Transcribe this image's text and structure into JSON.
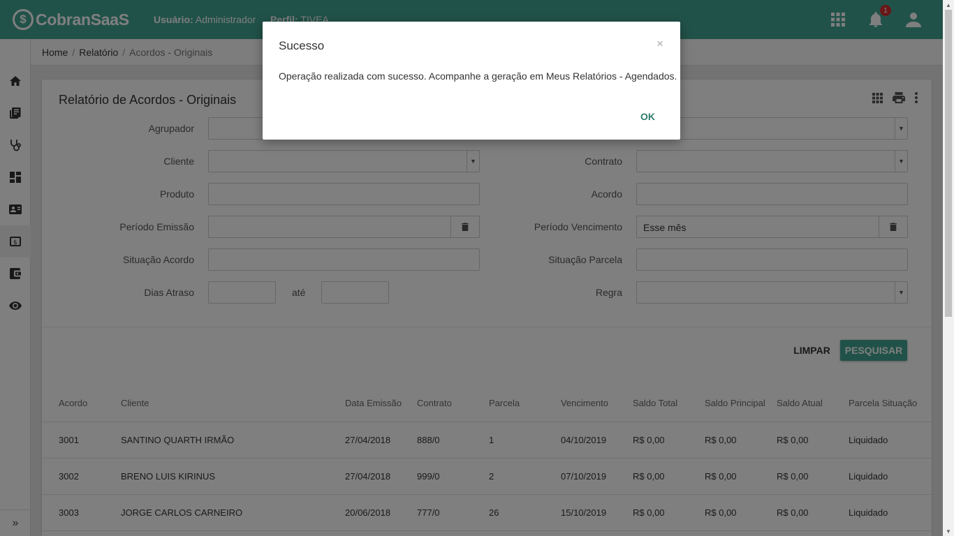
{
  "header": {
    "app_name": "CobranSaaS",
    "user_label": "Usuário:",
    "user_name": "Administrador",
    "profile_label": "Perfil:",
    "profile_name": "TIVEA",
    "notification_count": "1",
    "icons": [
      "apps-grid-icon",
      "bell-icon",
      "user-icon"
    ]
  },
  "sidebar": {
    "items": [
      "home-icon",
      "library-books-icon",
      "stethoscope-icon",
      "dashboard-icon",
      "contact-card-icon",
      "money-icon",
      "wallet-icon",
      "eye-icon"
    ],
    "expand_label": "»"
  },
  "breadcrumb": [
    "Home",
    "Relatório",
    "Acordos - Originais"
  ],
  "page": {
    "title": "Relatório de Acordos - Originais",
    "tools": [
      "grid-view-icon",
      "print-icon",
      "more-vert-icon"
    ]
  },
  "form": {
    "agrupador_label": "Agrupador",
    "cliente_label": "Cliente",
    "produto_label": "Produto",
    "periodo_emissao_label": "Período Emissão",
    "situacao_acordo_label": "Situação Acordo",
    "dias_atraso_label": "Dias Atraso",
    "ate_label": "até",
    "contrato_label": "Contrato",
    "acordo_label": "Acordo",
    "periodo_vencimento_label": "Período Vencimento",
    "periodo_vencimento_value": "Esse mês",
    "situacao_parcela_label": "Situação Parcela",
    "regra_label": "Regra",
    "clear_label": "LIMPAR",
    "search_label": "PESQUISAR"
  },
  "table": {
    "columns": [
      "Acordo",
      "Cliente",
      "Data Emissão",
      "Contrato",
      "Parcela",
      "Vencimento",
      "Saldo Total",
      "Saldo Principal",
      "Saldo Atual",
      "Parcela Situação"
    ],
    "rows": [
      [
        "3001",
        "SANTINO QUARTH IRMÃO",
        "27/04/2018",
        "888/0",
        "1",
        "04/10/2019",
        "R$ 0,00",
        "R$ 0,00",
        "R$ 0,00",
        "Liquidado"
      ],
      [
        "3002",
        "BRENO LUIS KIRINUS",
        "27/04/2018",
        "999/0",
        "2",
        "07/10/2019",
        "R$ 0,00",
        "R$ 0,00",
        "R$ 0,00",
        "Liquidado"
      ],
      [
        "3003",
        "JORGE CARLOS CARNEIRO",
        "20/06/2018",
        "777/0",
        "26",
        "15/10/2019",
        "R$ 0,00",
        "R$ 0,00",
        "R$ 0,00",
        "Liquidado"
      ]
    ]
  },
  "modal": {
    "title": "Sucesso",
    "close": "×",
    "message": "Operação realizada com sucesso. Acompanhe a geração em Meus Relatórios - Agendados.",
    "ok_label": "OK"
  },
  "colors": {
    "brand": "#43a592",
    "badge": "#d32f2f",
    "ok_text": "#2e7d6e"
  }
}
